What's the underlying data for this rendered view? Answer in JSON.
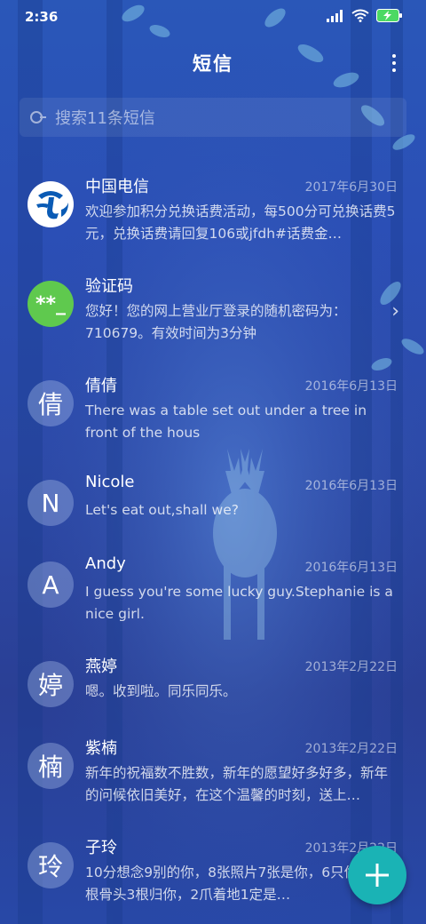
{
  "status_bar": {
    "time": "2:36"
  },
  "header": {
    "title": "短信",
    "menu_icon": "more-vert-icon"
  },
  "search": {
    "placeholder": "搜索11条短信"
  },
  "conversations": [
    {
      "name": "中国电信",
      "date": "2017年6月30日",
      "preview": "欢迎参加积分兑换话费活动，每500分可兑换话费5元，兑换话费请回复106或jfdh#话费金…",
      "avatar_icon": "china-telecom-logo",
      "avatar_text": ""
    },
    {
      "name": "验证码",
      "date": "",
      "preview": "您好！您的网上营业厅登录的随机密码为：710679。有效时间为3分钟",
      "avatar_text": "**_",
      "avatar_color": "#5fc94e"
    },
    {
      "name": "倩倩",
      "date": "2016年6月13日",
      "preview": "There was a table set out under a tree in front of the hous",
      "avatar_text": "倩"
    },
    {
      "name": "Nicole",
      "date": "2016年6月13日",
      "preview": "Let's eat out,shall we?",
      "avatar_text": "N"
    },
    {
      "name": "Andy",
      "date": "2016年6月13日",
      "preview": "I guess you're some lucky guy.Stephanie is a nice girl.",
      "avatar_text": "A"
    },
    {
      "name": "燕婷",
      "date": "2013年2月22日",
      "preview": "嗯。收到啦。同乐同乐。",
      "avatar_text": "婷"
    },
    {
      "name": "紫楠",
      "date": "2013年2月22日",
      "preview": "新年的祝福数不胜数，新年的愿望好多好多，新年的问候依旧美好，在这个温馨的时刻，送上…",
      "avatar_text": "楠"
    },
    {
      "name": "子玲",
      "date": "2013年2月22日",
      "preview": "10分想念9别的你，8张照片7张是你，6只像你，4根骨头3根归你，2爪着地1定是…",
      "avatar_text": "玲"
    }
  ],
  "fab": {
    "icon": "plus-icon"
  }
}
